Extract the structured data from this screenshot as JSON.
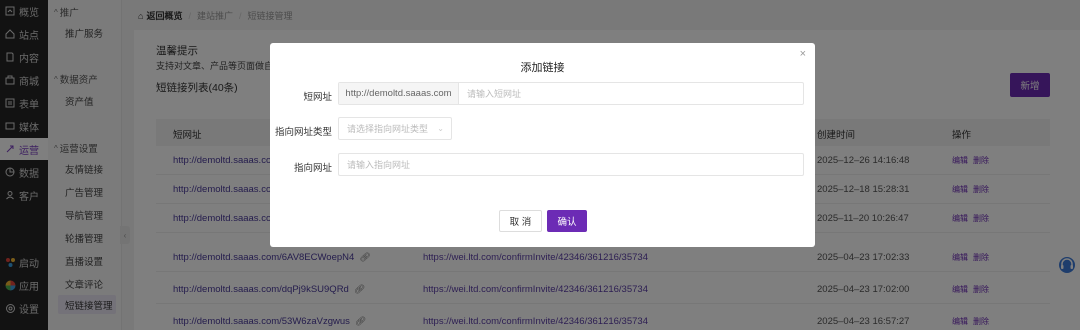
{
  "nav1": {
    "items": [
      {
        "label": "概览",
        "icon": "dashboard-icon"
      },
      {
        "label": "站点",
        "icon": "home-icon"
      },
      {
        "label": "内容",
        "icon": "document-icon"
      },
      {
        "label": "商城",
        "icon": "shop-icon"
      },
      {
        "label": "表单",
        "icon": "form-icon"
      },
      {
        "label": "媒体",
        "icon": "media-icon"
      },
      {
        "label": "运营",
        "icon": "operation-icon"
      },
      {
        "label": "数据",
        "icon": "data-icon"
      },
      {
        "label": "客户",
        "icon": "user-icon"
      }
    ],
    "bottom": [
      {
        "label": "启动",
        "icon": "launch-icon"
      },
      {
        "label": "应用",
        "icon": "apps-icon"
      },
      {
        "label": "设置",
        "icon": "gear-icon"
      }
    ]
  },
  "nav2": {
    "groups": [
      {
        "label": "推广",
        "items": [
          "推广服务"
        ]
      },
      {
        "label": "数据资产",
        "items": [
          "资产值"
        ]
      },
      {
        "label": "运营设置",
        "items": [
          "友情链接",
          "广告管理",
          "导航管理",
          "轮播管理",
          "直播设置",
          "文章评论",
          "短链接管理"
        ]
      }
    ]
  },
  "breadcrumb": {
    "home": "返回概览",
    "level1": "建站推广",
    "level2": "短链接管理"
  },
  "tip": {
    "title": "温馨提示",
    "desc": "支持对文章、产品等页面做自定义"
  },
  "list": {
    "title": "短链接列表(40条)",
    "new_button": "新增"
  },
  "table": {
    "headers": {
      "short": "短网址",
      "time": "创建时间",
      "ops": "操作"
    },
    "op_edit": "编辑",
    "op_delete": "删除",
    "rows": [
      {
        "short": "http://demoltd.saaas.com/",
        "target": "",
        "time": "2025–12–26 14:16:48"
      },
      {
        "short": "http://demoltd.saaas.com/",
        "target": "",
        "time": "2025–12–18 15:28:31"
      },
      {
        "short": "http://demoltd.saaas.com/",
        "target": "",
        "time": "2025–11–20 10:26:47"
      },
      {
        "short": "http://demoltd.saaas.com/6AV8ECWoepN4",
        "target": "https://wei.ltd.com/confirmInvite/42346/361216/35734",
        "time": "2025–04–23 17:02:33"
      },
      {
        "short": "http://demoltd.saaas.com/dqPj9kSU9QRd",
        "target": "https://wei.ltd.com/confirmInvite/42346/361216/35734",
        "time": "2025–04–23 17:02:00"
      },
      {
        "short": "http://demoltd.saaas.com/53W6zaVzgwus",
        "target": "https://wei.ltd.com/confirmInvite/42346/361216/35734",
        "time": "2025–04–23 16:57:27"
      }
    ]
  },
  "modal": {
    "title": "添加链接",
    "short_label": "短网址",
    "short_prefix": "http://demoltd.saaas.com",
    "short_placeholder": "请输入短网址",
    "type_label": "指向网址类型",
    "type_placeholder": "请选择指向网址类型",
    "target_label": "指向网址",
    "target_placeholder": "请输入指向网址",
    "cancel": "取 消",
    "confirm": "确认"
  },
  "colors": {
    "accent": "#6c2bb5",
    "sidebar": "#252525"
  }
}
